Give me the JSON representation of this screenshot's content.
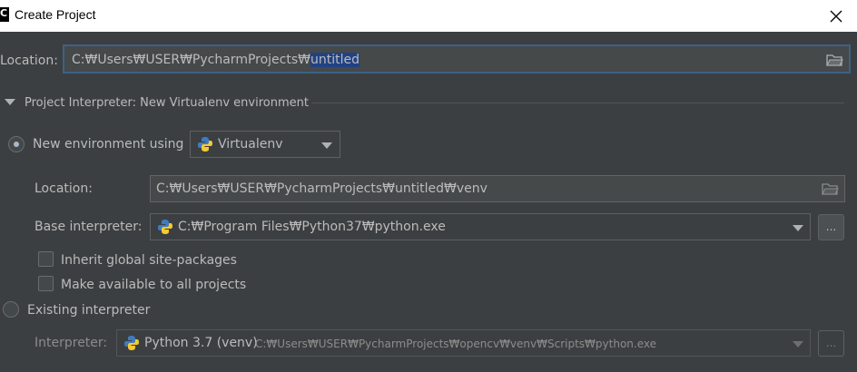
{
  "window": {
    "title": "Create Project",
    "app_icon": "pycharm-icon",
    "app_icon_letter": "C",
    "close_icon": "close-icon"
  },
  "project": {
    "location_label": "Location:",
    "location_prefix": "C:₩Users₩USER₩PycharmProjects₩",
    "location_selected": "untitled",
    "folder_icon": "folder-icon"
  },
  "interpreter_section": {
    "header": "Project Interpreter: New Virtualenv environment",
    "expanded": true,
    "new_env": {
      "radio_label": "New environment using",
      "selected": true,
      "tool_value": "Virtualenv",
      "tool_icon": "python-icon",
      "location_label": "Location:",
      "location_value": "C:₩Users₩USER₩PycharmProjects₩untitled₩venv",
      "base_label": "Base interpreter:",
      "base_value": "C:₩Program Files₩Python37₩python.exe",
      "browse_label": "...",
      "inherit_label": "Inherit global site-packages",
      "inherit_checked": false,
      "available_label": "Make available to all projects",
      "available_checked": false
    },
    "existing": {
      "radio_label": "Existing interpreter",
      "selected": false,
      "interpreter_label": "Interpreter:",
      "interpreter_name": "Python 3.7 (venv)",
      "interpreter_path": "C:₩Users₩USER₩PycharmProjects₩opencv₩venv₩Scripts₩python.exe",
      "browse_label": "..."
    }
  },
  "colors": {
    "background": "#3c3f41",
    "selection": "#214283",
    "focus_border": "#3d6185"
  }
}
